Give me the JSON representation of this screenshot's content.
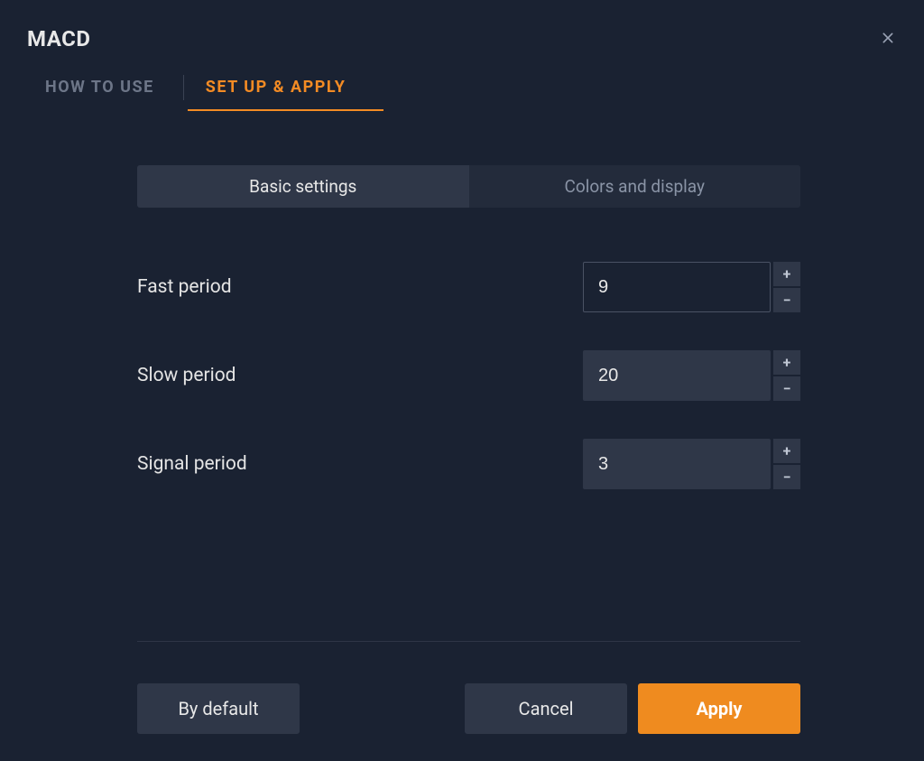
{
  "modal": {
    "title": "MACD",
    "tabs": {
      "how_to_use": "HOW TO USE",
      "set_up_apply": "SET UP & APPLY"
    },
    "subtabs": {
      "basic": "Basic settings",
      "colors": "Colors and display"
    },
    "fields": {
      "fast_period": {
        "label": "Fast period",
        "value": "9"
      },
      "slow_period": {
        "label": "Slow period",
        "value": "20"
      },
      "signal_period": {
        "label": "Signal period",
        "value": "3"
      }
    },
    "buttons": {
      "by_default": "By default",
      "cancel": "Cancel",
      "apply": "Apply"
    }
  }
}
